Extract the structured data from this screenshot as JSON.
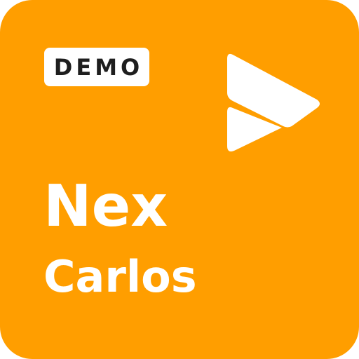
{
  "badge": {
    "label": "DEMO"
  },
  "title": {
    "line1": "Nex",
    "line2": "Carlos"
  },
  "logo": {
    "icon": "play-icon"
  },
  "colors": {
    "background": "#FF9E00",
    "text": "#FFFFFF",
    "badge_bg": "#FFFFFF",
    "badge_text": "#1E1E1E"
  }
}
